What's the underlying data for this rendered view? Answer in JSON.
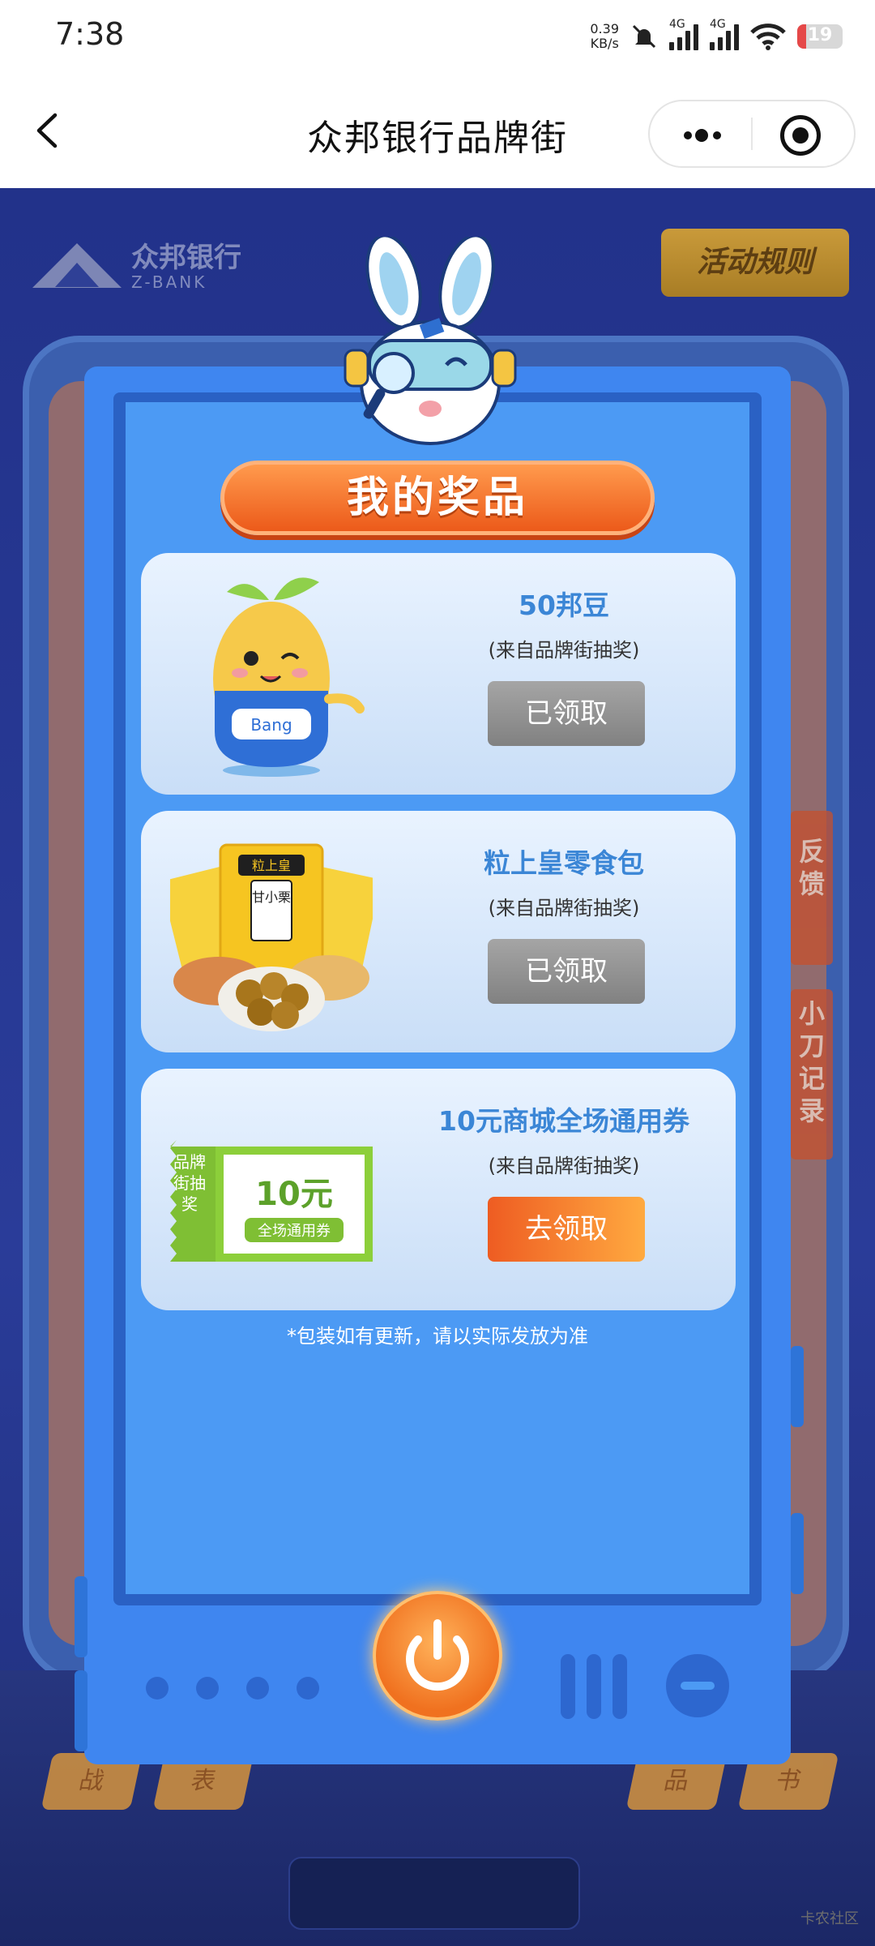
{
  "status_bar": {
    "time": "7:38",
    "net_speed": "0.39",
    "net_unit": "KB/s",
    "sim1": "4G",
    "sim2": "4G",
    "battery": "19",
    "battery_level": 0.19
  },
  "navbar": {
    "title": "众邦银行品牌街"
  },
  "header": {
    "bank_name": "众邦银行",
    "bank_name_en": "Z-BANK",
    "rules_label": "活动规则"
  },
  "modal": {
    "title": "我的奖品",
    "prizes": [
      {
        "name": "50邦豆",
        "source": "(来自品牌街抽奖)",
        "button": "已领取",
        "status": "claimed"
      },
      {
        "name": "粒上皇零食包",
        "source": "(来自品牌街抽奖)",
        "button": "已领取",
        "status": "claimed"
      },
      {
        "name": "10元商城全场通用券",
        "source": "(来自品牌街抽奖)",
        "button": "去领取",
        "status": "unclaimed"
      }
    ],
    "coupon": {
      "tag": "品牌街抽奖",
      "amount": "10元",
      "desc": "全场通用券"
    },
    "snack_pack": {
      "brand": "粒上皇",
      "product": "甘小栗"
    },
    "mascot": {
      "apron_text": "Bang"
    },
    "note": "*包装如有更新，请以实际发放为准"
  },
  "background": {
    "side_tabs": [
      "反馈",
      "小刀记录"
    ],
    "floor_keys": [
      "战",
      "表",
      "品",
      "书"
    ]
  },
  "watermark": "卡农社区",
  "colors": {
    "primary_blue": "#3f86f0",
    "title_orange": "#ec5a1a",
    "prize_text": "#3b86d6",
    "claimed_gray": "#8f8f8f",
    "claim_orange": "#f57a2b"
  }
}
